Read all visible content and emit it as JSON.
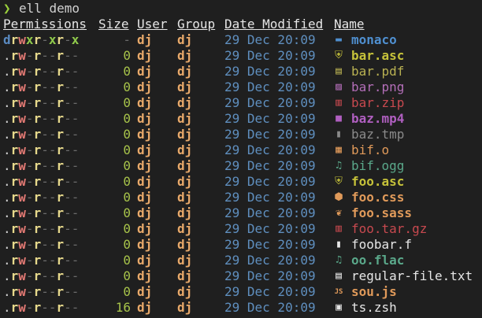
{
  "prompt": {
    "symbol": "❯",
    "command": "ell demo"
  },
  "headers": {
    "permissions": "Permissions",
    "size": "Size",
    "user": "User",
    "group": "Group",
    "date": "Date Modified",
    "name": "Name"
  },
  "rows": [
    {
      "perm": "drwxr-xr-x",
      "size": "-",
      "user": "dj",
      "group": "dj",
      "date": "29 Dec 20:09",
      "icon": "▬",
      "icon_name": "folder-icon",
      "name": "monaco",
      "color": "#4f8fcf",
      "bold": true
    },
    {
      "perm": ".rw-r--r--",
      "size": "0",
      "user": "dj",
      "group": "dj",
      "date": "29 Dec 20:09",
      "icon": "⛨",
      "icon_name": "shield-icon",
      "name": "bar.asc",
      "color": "#c6c23a",
      "bold": true
    },
    {
      "perm": ".rw-r--r--",
      "size": "0",
      "user": "dj",
      "group": "dj",
      "date": "29 Dec 20:09",
      "icon": "▤",
      "icon_name": "pdf-file-icon",
      "name": "bar.pdf",
      "color": "#b9b152",
      "bold": false
    },
    {
      "perm": ".rw-r--r--",
      "size": "0",
      "user": "dj",
      "group": "dj",
      "date": "29 Dec 20:09",
      "icon": "▨",
      "icon_name": "image-file-icon",
      "name": "bar.png",
      "color": "#b36eb8",
      "bold": false
    },
    {
      "perm": ".rw-r--r--",
      "size": "0",
      "user": "dj",
      "group": "dj",
      "date": "29 Dec 20:09",
      "icon": "▥",
      "icon_name": "archive-file-icon",
      "name": "bar.zip",
      "color": "#c8494f",
      "bold": false
    },
    {
      "perm": ".rw-r--r--",
      "size": "0",
      "user": "dj",
      "group": "dj",
      "date": "29 Dec 20:09",
      "icon": "■",
      "icon_name": "video-file-icon",
      "name": "baz.mp4",
      "color": "#b05fc0",
      "bold": true
    },
    {
      "perm": ".rw-r--r--",
      "size": "0",
      "user": "dj",
      "group": "dj",
      "date": "29 Dec 20:09",
      "icon": "▮",
      "icon_name": "temp-file-icon",
      "name": "baz.tmp",
      "color": "#8a8a8a",
      "bold": false
    },
    {
      "perm": ".rw-r--r--",
      "size": "0",
      "user": "dj",
      "group": "dj",
      "date": "29 Dec 20:09",
      "icon": "▦",
      "icon_name": "object-file-icon",
      "name": "bif.o",
      "color": "#e09a5a",
      "bold": false
    },
    {
      "perm": ".rw-r--r--",
      "size": "0",
      "user": "dj",
      "group": "dj",
      "date": "29 Dec 20:09",
      "icon": "♫",
      "icon_name": "audio-file-icon",
      "name": "bif.ogg",
      "color": "#5aa88a",
      "bold": false
    },
    {
      "perm": ".rw-r--r--",
      "size": "0",
      "user": "dj",
      "group": "dj",
      "date": "29 Dec 20:09",
      "icon": "⛨",
      "icon_name": "shield-icon",
      "name": "foo.asc",
      "color": "#c6c23a",
      "bold": true
    },
    {
      "perm": ".rw-r--r--",
      "size": "0",
      "user": "dj",
      "group": "dj",
      "date": "29 Dec 20:09",
      "icon": "⬢",
      "icon_name": "css-file-icon",
      "name": "foo.css",
      "color": "#e09a5a",
      "bold": true
    },
    {
      "perm": ".rw-r--r--",
      "size": "0",
      "user": "dj",
      "group": "dj",
      "date": "29 Dec 20:09",
      "icon": "❦",
      "icon_name": "sass-file-icon",
      "name": "foo.sass",
      "color": "#e09a5a",
      "bold": true
    },
    {
      "perm": ".rw-r--r--",
      "size": "0",
      "user": "dj",
      "group": "dj",
      "date": "29 Dec 20:09",
      "icon": "▥",
      "icon_name": "archive-file-icon",
      "name": "foo.tar.gz",
      "color": "#c8494f",
      "bold": false
    },
    {
      "perm": ".rw-r--r--",
      "size": "0",
      "user": "dj",
      "group": "dj",
      "date": "29 Dec 20:09",
      "icon": "▮",
      "icon_name": "file-icon",
      "name": "foobar.f",
      "color": "#e6e6e6",
      "bold": false
    },
    {
      "perm": ".rw-r--r--",
      "size": "0",
      "user": "dj",
      "group": "dj",
      "date": "29 Dec 20:09",
      "icon": "♫",
      "icon_name": "audio-file-icon",
      "name": "oo.flac",
      "color": "#5aa88a",
      "bold": true
    },
    {
      "perm": ".rw-r--r--",
      "size": "0",
      "user": "dj",
      "group": "dj",
      "date": "29 Dec 20:09",
      "icon": "▤",
      "icon_name": "text-file-icon",
      "name": "regular-file.txt",
      "color": "#e6e6e6",
      "bold": false
    },
    {
      "perm": ".rw-r--r--",
      "size": "0",
      "user": "dj",
      "group": "dj",
      "date": "29 Dec 20:09",
      "icon": "JS",
      "icon_name": "javascript-file-icon",
      "name": "sou.js",
      "color": "#e09a5a",
      "bold": true
    },
    {
      "perm": ".rw-r--r--",
      "size": "16",
      "user": "dj",
      "group": "dj",
      "date": "29 Dec 20:09",
      "icon": "▣",
      "icon_name": "shell-script-icon",
      "name": "ts.zsh",
      "color": "#e6e6e6",
      "bold": false
    }
  ]
}
